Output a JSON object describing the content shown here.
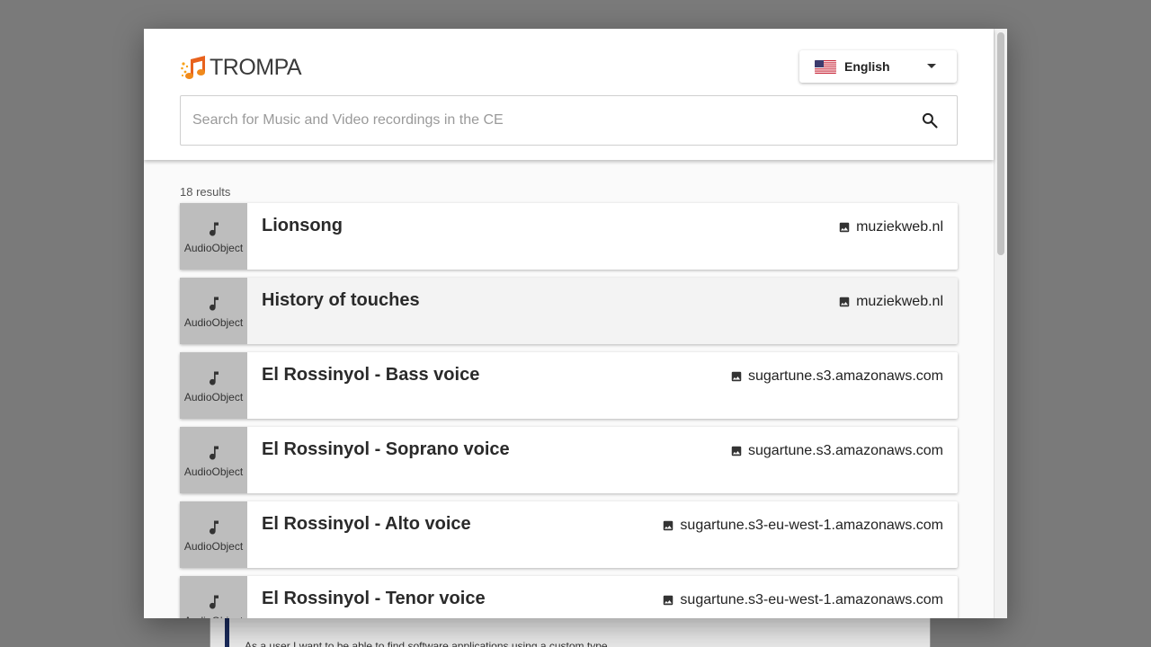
{
  "brand": {
    "name": "TROMPA",
    "mark_colors": [
      "#f7a21b",
      "#e8621d"
    ]
  },
  "language": {
    "selected": "English",
    "flag": "us-flag-icon"
  },
  "search": {
    "placeholder": "Search for Music and Video recordings in the CE",
    "value": ""
  },
  "results": {
    "count_label": "18 results",
    "items": [
      {
        "type": "AudioObject",
        "title": "Lionsong",
        "source": "muziekweb.nl"
      },
      {
        "type": "AudioObject",
        "title": "History of touches",
        "source": "muziekweb.nl"
      },
      {
        "type": "AudioObject",
        "title": "El Rossinyol - Bass voice",
        "source": "sugartune.s3.amazonaws.com"
      },
      {
        "type": "AudioObject",
        "title": "El Rossinyol - Soprano voice",
        "source": "sugartune.s3.amazonaws.com"
      },
      {
        "type": "AudioObject",
        "title": "El Rossinyol - Alto voice",
        "source": "sugartune.s3-eu-west-1.amazonaws.com"
      },
      {
        "type": "AudioObject",
        "title": "El Rossinyol - Tenor voice",
        "source": "sugartune.s3-eu-west-1.amazonaws.com"
      }
    ]
  },
  "background_page": {
    "text": "As a user I want to be able to find software applications using a custom type"
  }
}
